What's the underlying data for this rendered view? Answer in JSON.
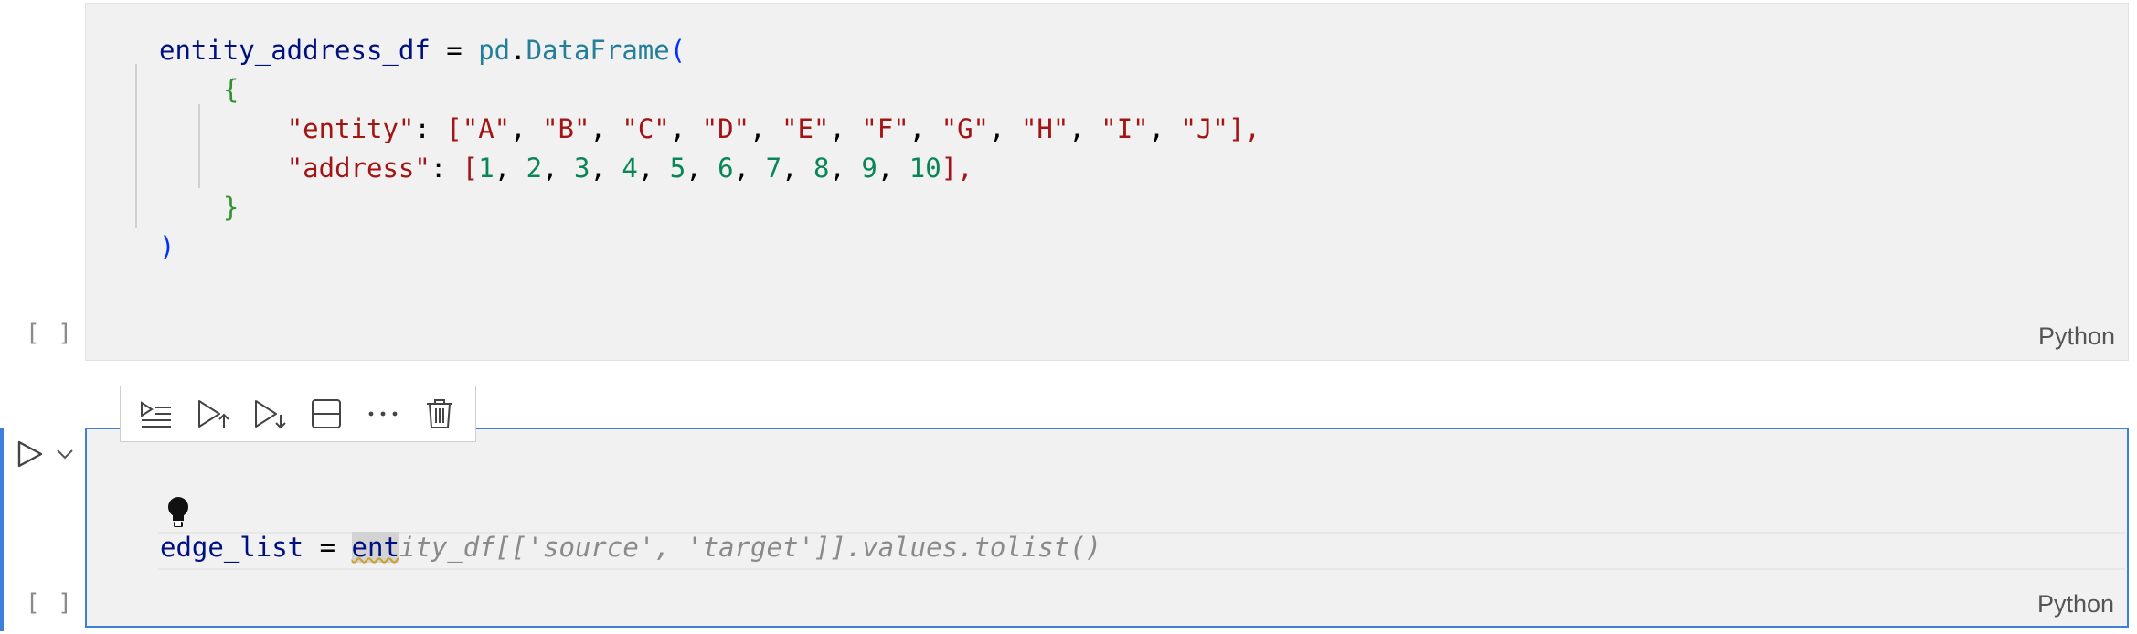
{
  "cell1": {
    "code": {
      "l1_var": "entity_address_df",
      "l1_eq": " = ",
      "l1_mod": "pd",
      "l1_dot": ".",
      "l1_cls": "DataFrame",
      "l1_paren": "(",
      "l2_brace": "{",
      "l3_key": "\"entity\"",
      "l3_colon": ": ",
      "l3_open": "[",
      "l3_values": [
        "\"A\"",
        "\"B\"",
        "\"C\"",
        "\"D\"",
        "\"E\"",
        "\"F\"",
        "\"G\"",
        "\"H\"",
        "\"I\"",
        "\"J\""
      ],
      "l3_close": "],",
      "l4_key": "\"address\"",
      "l4_colon": ": ",
      "l4_open": "[",
      "l4_values": [
        "1",
        "2",
        "3",
        "4",
        "5",
        "6",
        "7",
        "8",
        "9",
        "10"
      ],
      "l4_close": "],",
      "l5_brace": "}",
      "l6_paren": ")"
    },
    "exec_count": "[ ]",
    "language": "Python"
  },
  "toolbar": {
    "items": [
      {
        "icon": "run-by-line-icon",
        "label": "Run by line"
      },
      {
        "icon": "execute-above-icon",
        "label": "Execute above cells"
      },
      {
        "icon": "execute-below-icon",
        "label": "Execute cell and below"
      },
      {
        "icon": "split-cell-icon",
        "label": "Split cell"
      },
      {
        "icon": "more-actions-icon",
        "label": "More actions"
      },
      {
        "icon": "delete-icon",
        "label": "Delete cell"
      }
    ]
  },
  "cell2": {
    "code": {
      "var": "edge_list",
      "eq": " = ",
      "typed": "ent",
      "ghost": "ity_df[['source', 'target']].values.tolist()"
    },
    "exec_count": "[ ]",
    "language": "Python"
  },
  "colors": {
    "focus_border": "#3d7fd9",
    "cell_bg": "#f1f1f1",
    "string": "#a31515",
    "number": "#098658",
    "variable": "#001080",
    "class": "#267f99"
  }
}
